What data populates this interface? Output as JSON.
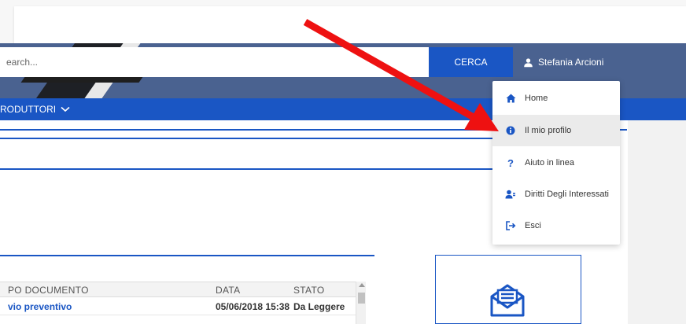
{
  "search": {
    "value": "earch...",
    "button_label": "CERCA"
  },
  "user": {
    "name": "Stefania Arcioni"
  },
  "nav": {
    "item_label": "RODUTTORI"
  },
  "menu": {
    "items": [
      {
        "label": "Home",
        "icon": "home-icon"
      },
      {
        "label": "Il mio profilo",
        "icon": "info-icon"
      },
      {
        "label": "Aiuto in linea",
        "icon": "question-icon"
      },
      {
        "label": "Diritti Degli Interessati",
        "icon": "user-rights-icon"
      },
      {
        "label": "Esci",
        "icon": "logout-icon"
      }
    ],
    "active_index": 1
  },
  "table": {
    "headers": [
      "PO DOCUMENTO",
      "DATA",
      "STATO"
    ],
    "rows": [
      {
        "tipo": "vio preventivo",
        "data": "05/06/2018 15:38",
        "stato": "Da Leggere"
      }
    ]
  },
  "colors": {
    "brand_blue": "#1a56c4",
    "header_slate": "#4a6290",
    "annotation_red": "#ee1111"
  }
}
